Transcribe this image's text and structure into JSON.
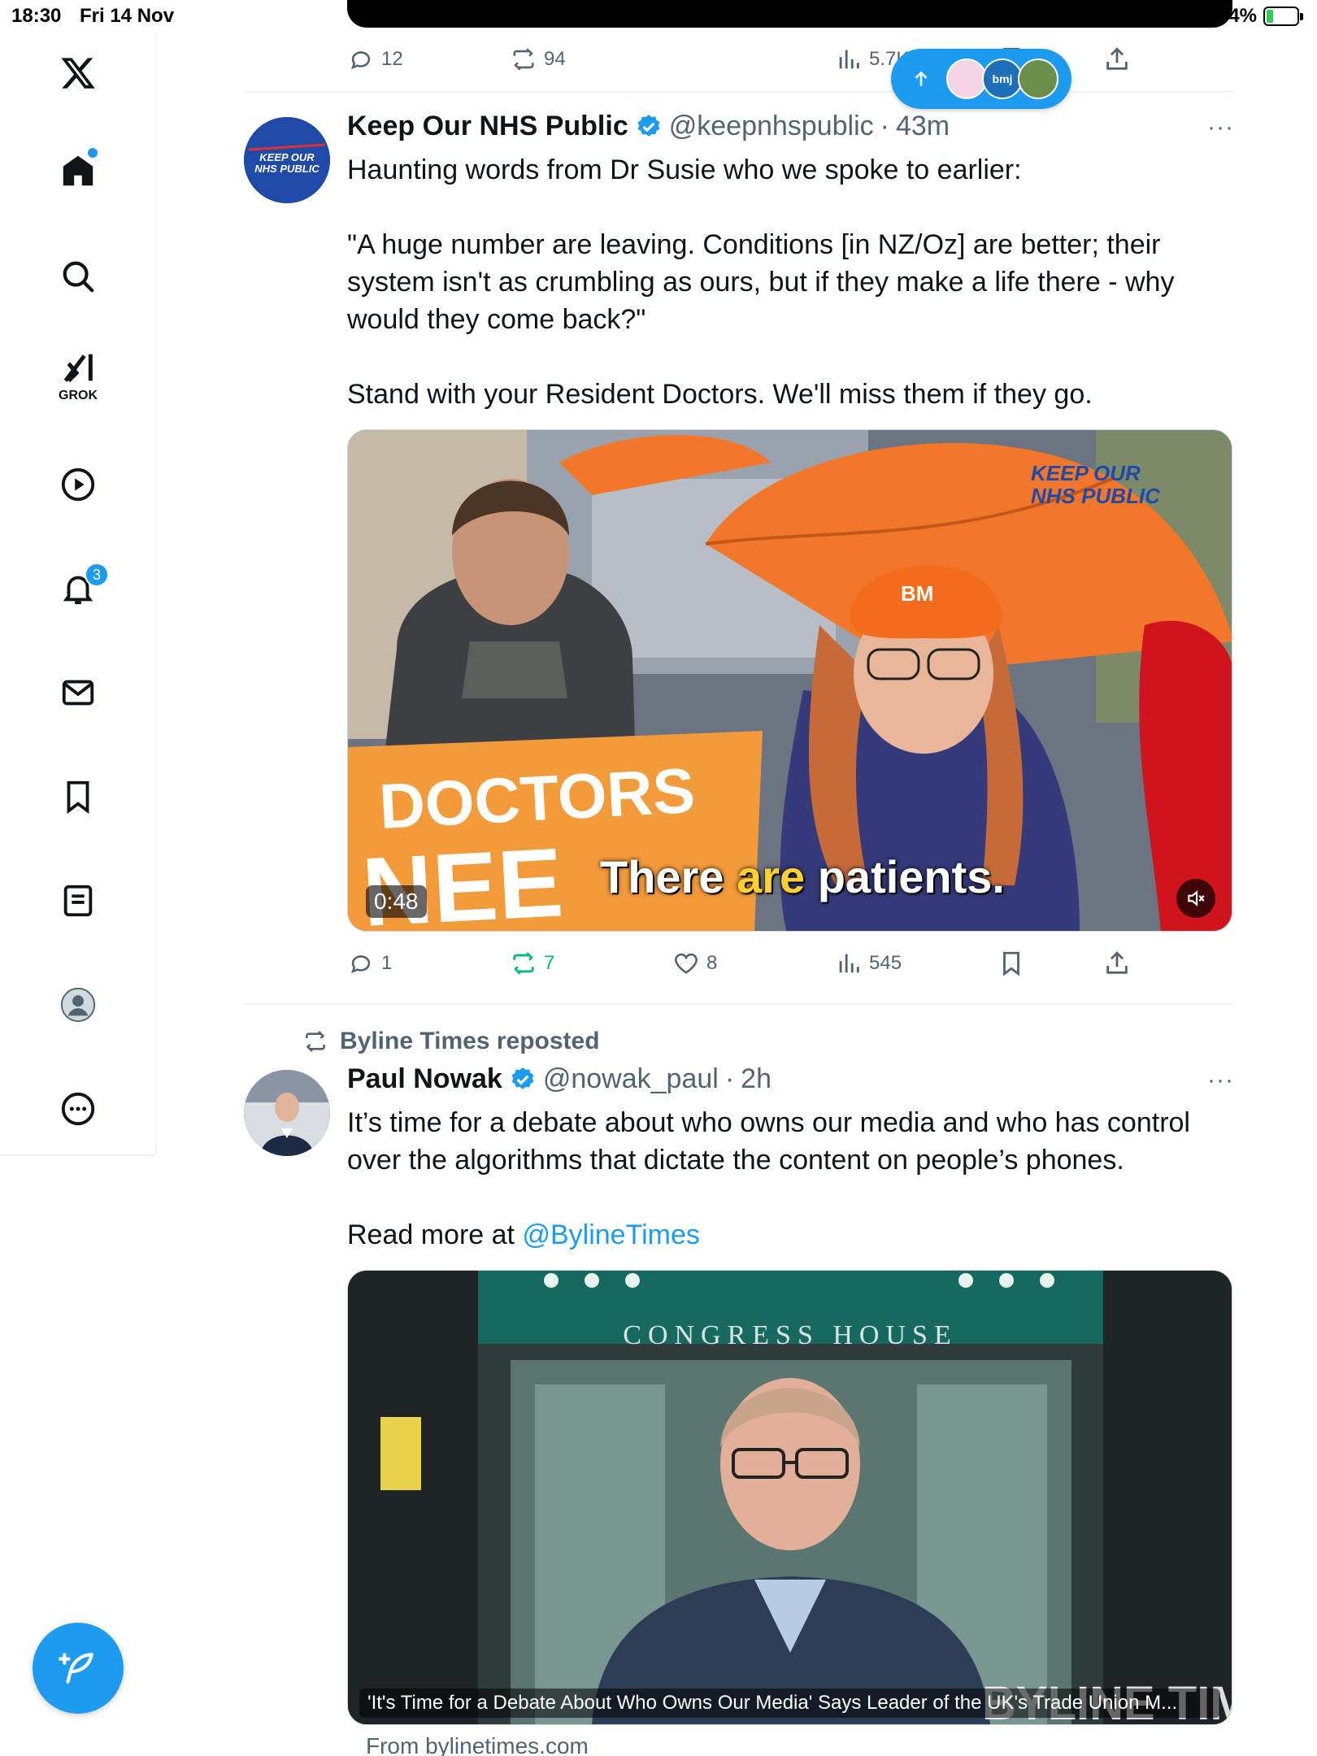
{
  "status_bar": {
    "time": "18:30",
    "date": "Fri 14 Nov",
    "battery": "4%"
  },
  "sidebar": {
    "grok_label": "GROK",
    "notifications_count": "3"
  },
  "prev_post": {
    "replies": "12",
    "reposts": "94",
    "views": "5.7K"
  },
  "post1": {
    "avatar_text": "KEEP OUR NHS PUBLIC",
    "name": "Keep Our NHS Public",
    "handle": "@keepnhspublic",
    "separator": "·",
    "ago": "43m",
    "more": "···",
    "para1": "Haunting words from Dr Susie who we spoke to earlier:",
    "para2": "\"A huge number are leaving. Conditions [in NZ/Oz] are better; their system isn't as crumbling as ours, but if they make a life there - why would they come back?\"",
    "para3": "Stand with your Resident Doctors. We'll miss them if they go.",
    "video_duration": "0:48",
    "caption_a": "There",
    "caption_b": "are",
    "caption_c": "patients.",
    "sign_line1": "DOCTORS",
    "sign_line2": "NEE",
    "watermark_line1": "KEEP OUR",
    "watermark_line2": "NHS PUBLIC",
    "hat_text": "BM",
    "replies": "1",
    "reposts": "7",
    "likes": "8",
    "views": "545"
  },
  "post2": {
    "reposted_by": "Byline Times reposted",
    "name": "Paul Nowak",
    "handle": "@nowak_paul",
    "separator": "·",
    "ago": "2h",
    "more": "···",
    "para1": "It’s time for a debate about who owns our media and who has control over the algorithms that dictate the content on people’s phones.",
    "para2_prefix": "Read more at ",
    "mention": "@BylineTimes",
    "building_sign": "CONGRESS HOUSE",
    "card_title": "'It's Time for a Debate About Who Owns Our Media' Says Leader of the UK's Trade Union M...",
    "card_source": "From bylinetimes.com",
    "brand_overlay": "BYLINE TIMES"
  },
  "new_posts_pill": {
    "avatar_label": "bmj"
  },
  "colors": {
    "accent": "#1d9bf0",
    "text": "#0f1419",
    "muted": "#536471",
    "repost_green": "#00ba7c"
  }
}
